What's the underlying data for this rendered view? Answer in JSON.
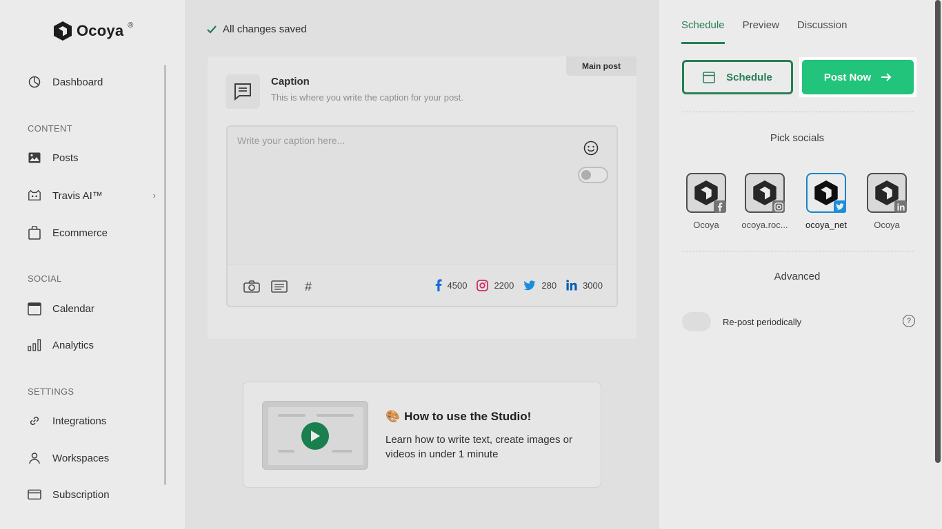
{
  "brand": {
    "name": "Ocoya",
    "registered": "®"
  },
  "sidebar": {
    "items": [
      {
        "label": "Dashboard",
        "icon": "dashboard-icon"
      },
      {
        "label": "Posts",
        "icon": "image-icon"
      },
      {
        "label": "Travis AI™",
        "icon": "robot-icon"
      },
      {
        "label": "Ecommerce",
        "icon": "bag-icon"
      },
      {
        "label": "Calendar",
        "icon": "calendar-icon"
      },
      {
        "label": "Analytics",
        "icon": "analytics-icon"
      },
      {
        "label": "Integrations",
        "icon": "link-icon"
      },
      {
        "label": "Workspaces",
        "icon": "user-icon"
      },
      {
        "label": "Subscription",
        "icon": "card-icon"
      }
    ],
    "sections": {
      "content": "CONTENT",
      "social": "SOCIAL",
      "settings": "SETTINGS"
    }
  },
  "editor": {
    "save_status": "All changes saved",
    "badge": "Main post",
    "caption_title": "Caption",
    "caption_subtitle": "This is where you write the caption for your post.",
    "placeholder": "Write your caption here...",
    "limits": {
      "facebook": "4500",
      "instagram": "2200",
      "twitter": "280",
      "linkedin": "3000"
    },
    "hashtag": "#"
  },
  "tutorial": {
    "emoji": "🎨",
    "title": "How to use the Studio!",
    "description": "Learn how to write text, create images or videos in under 1 minute"
  },
  "right_panel": {
    "tabs": [
      "Schedule",
      "Preview",
      "Discussion"
    ],
    "active_tab": "Schedule",
    "schedule_button": "Schedule",
    "post_now_button": "Post Now",
    "pick_socials": "Pick socials",
    "socials": [
      {
        "label": "Ocoya",
        "network": "facebook",
        "selected": false
      },
      {
        "label": "ocoya.roc...",
        "network": "instagram",
        "selected": false
      },
      {
        "label": "ocoya_net",
        "network": "twitter",
        "selected": true
      },
      {
        "label": "Ocoya",
        "network": "linkedin",
        "selected": false
      }
    ],
    "advanced": "Advanced",
    "repost_label": "Re-post periodically",
    "help": "?"
  },
  "colors": {
    "accent": "#2a8a5c",
    "button_green": "#22c37a",
    "twitter": "#1d9bf0"
  }
}
